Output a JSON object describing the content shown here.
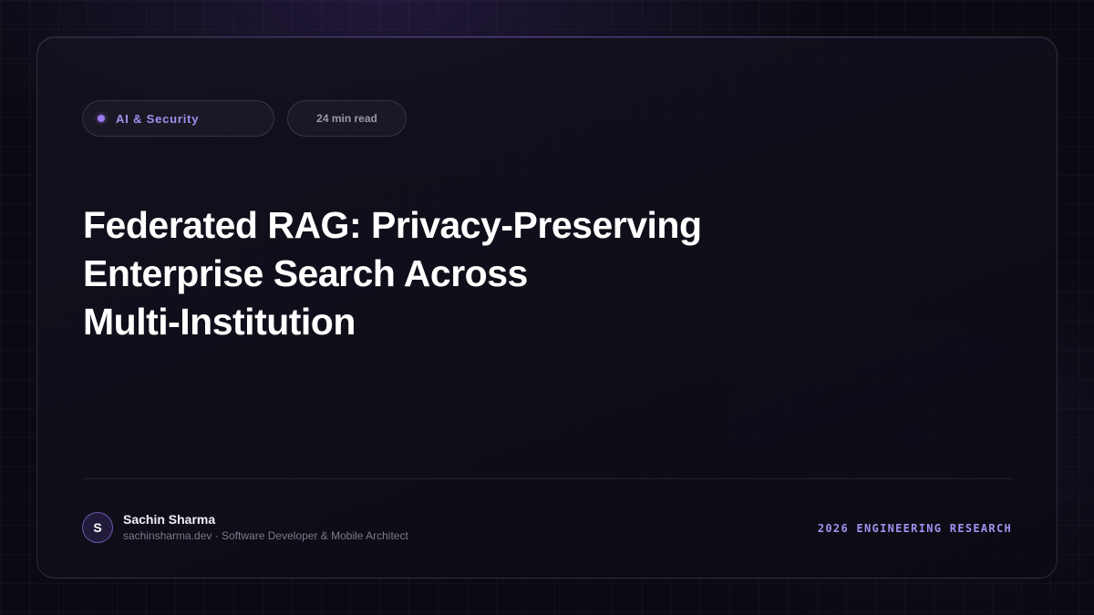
{
  "tags": {
    "category": "AI & Security",
    "read_time": "24 min read"
  },
  "article": {
    "title_lines": [
      "Federated RAG: Privacy-Preserving",
      "Enterprise Search Across",
      "Multi-Institution"
    ]
  },
  "author": {
    "initial": "S",
    "name": "Sachin Sharma",
    "meta": "sachinsharma.dev · Software Developer & Mobile Architect"
  },
  "footer": {
    "label": "2026 ENGINEERING RESEARCH"
  },
  "colors": {
    "accent": "#9b7bf0",
    "accent_text": "#a48ff0",
    "background": "#0b0a12",
    "title": "#ffffff"
  },
  "icons": {
    "category_dot": "dot-icon"
  }
}
